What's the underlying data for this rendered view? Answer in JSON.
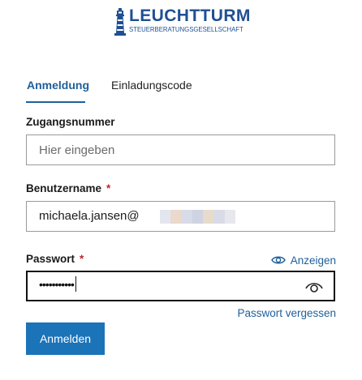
{
  "brand": {
    "name": "LEUCHTTURM",
    "tagline": "STEUERBERATUNGSGESELLSCHAFT",
    "color": "#1f4f93"
  },
  "tabs": [
    {
      "label": "Anmeldung",
      "active": true
    },
    {
      "label": "Einladungscode",
      "active": false
    }
  ],
  "form": {
    "access_number": {
      "label": "Zugangsnummer",
      "placeholder": "Hier eingeben",
      "value": ""
    },
    "username": {
      "label": "Benutzername",
      "required_mark": "*",
      "value": "michaela.jansen@"
    },
    "password": {
      "label": "Passwort",
      "required_mark": "*",
      "value_masked": "•••••••••••",
      "show_label": "Anzeigen"
    },
    "forgot_password": "Passwort vergessen",
    "submit_label": "Anmelden"
  },
  "colors": {
    "accent": "#1f5f9a",
    "button": "#1b73b8",
    "required": "#c0262d"
  },
  "icons": {
    "show_password": "eye-icon",
    "toggle_visibility": "eye-icon"
  }
}
